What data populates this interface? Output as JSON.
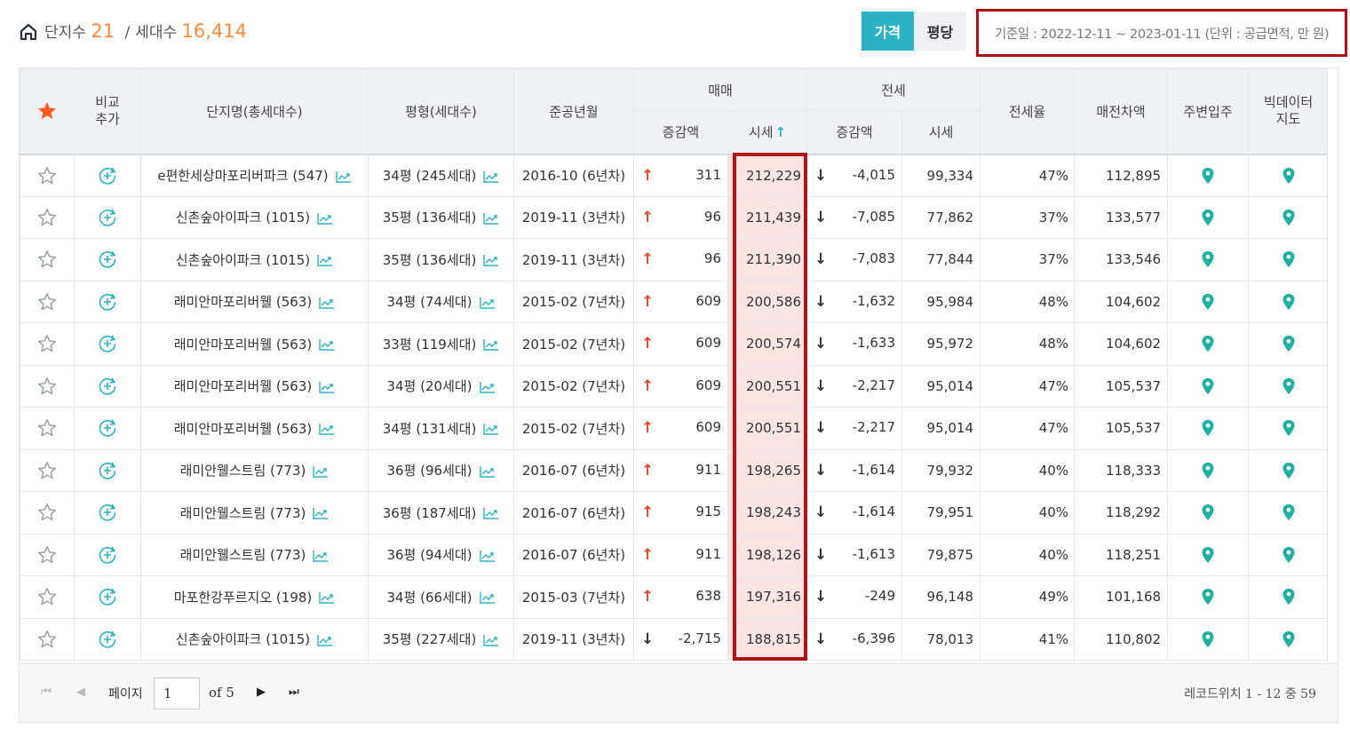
{
  "summary": {
    "complex_label": "단지수",
    "complex_count": "21",
    "separator": "/",
    "household_label": "세대수",
    "household_count": "16,414"
  },
  "toggle": {
    "price_label": "가격",
    "per_pyeong_label": "평당"
  },
  "basis_text": "기준일 : 2022-12-11 ~ 2023-01-11 (단위 : 공급면적, 만 원)",
  "headers": {
    "compare_line1": "비교",
    "compare_line2": "추가",
    "name": "단지명(총세대수)",
    "pyeong": "평형(세대수)",
    "built": "준공년월",
    "sale_group": "매매",
    "jeonse_group": "전세",
    "sale_change": "증감액",
    "sale_price": "시세",
    "jeonse_change": "증감액",
    "jeonse_price": "시세",
    "jeonse_rate": "전세율",
    "gap": "매전차액",
    "nearby": "주변입주",
    "bigdata_line1": "빅데이터",
    "bigdata_line2": "지도"
  },
  "rows": [
    {
      "name": "e편한세상마포리버파크 (547)",
      "pyeong": "34평 (245세대)",
      "built": "2016-10 (6년차)",
      "sale_dir": "up",
      "sale_change": "311",
      "sale_price": "212,229",
      "jeonse_dir": "down",
      "jeonse_change": "-4,015",
      "jeonse_price": "99,334",
      "rate": "47%",
      "gap": "112,895"
    },
    {
      "name": "신촌숲아이파크 (1015)",
      "pyeong": "35평 (136세대)",
      "built": "2019-11 (3년차)",
      "sale_dir": "up",
      "sale_change": "96",
      "sale_price": "211,439",
      "jeonse_dir": "down",
      "jeonse_change": "-7,085",
      "jeonse_price": "77,862",
      "rate": "37%",
      "gap": "133,577"
    },
    {
      "name": "신촌숲아이파크 (1015)",
      "pyeong": "35평 (136세대)",
      "built": "2019-11 (3년차)",
      "sale_dir": "up",
      "sale_change": "96",
      "sale_price": "211,390",
      "jeonse_dir": "down",
      "jeonse_change": "-7,083",
      "jeonse_price": "77,844",
      "rate": "37%",
      "gap": "133,546"
    },
    {
      "name": "래미안마포리버웰 (563)",
      "pyeong": "34평 (74세대)",
      "built": "2015-02 (7년차)",
      "sale_dir": "up",
      "sale_change": "609",
      "sale_price": "200,586",
      "jeonse_dir": "down",
      "jeonse_change": "-1,632",
      "jeonse_price": "95,984",
      "rate": "48%",
      "gap": "104,602"
    },
    {
      "name": "래미안마포리버웰 (563)",
      "pyeong": "33평 (119세대)",
      "built": "2015-02 (7년차)",
      "sale_dir": "up",
      "sale_change": "609",
      "sale_price": "200,574",
      "jeonse_dir": "down",
      "jeonse_change": "-1,633",
      "jeonse_price": "95,972",
      "rate": "48%",
      "gap": "104,602"
    },
    {
      "name": "래미안마포리버웰 (563)",
      "pyeong": "34평 (20세대)",
      "built": "2015-02 (7년차)",
      "sale_dir": "up",
      "sale_change": "609",
      "sale_price": "200,551",
      "jeonse_dir": "down",
      "jeonse_change": "-2,217",
      "jeonse_price": "95,014",
      "rate": "47%",
      "gap": "105,537"
    },
    {
      "name": "래미안마포리버웰 (563)",
      "pyeong": "34평 (131세대)",
      "built": "2015-02 (7년차)",
      "sale_dir": "up",
      "sale_change": "609",
      "sale_price": "200,551",
      "jeonse_dir": "down",
      "jeonse_change": "-2,217",
      "jeonse_price": "95,014",
      "rate": "47%",
      "gap": "105,537"
    },
    {
      "name": "래미안웰스트림 (773)",
      "pyeong": "36평 (96세대)",
      "built": "2016-07 (6년차)",
      "sale_dir": "up",
      "sale_change": "911",
      "sale_price": "198,265",
      "jeonse_dir": "down",
      "jeonse_change": "-1,614",
      "jeonse_price": "79,932",
      "rate": "40%",
      "gap": "118,333"
    },
    {
      "name": "래미안웰스트림 (773)",
      "pyeong": "36평 (187세대)",
      "built": "2016-07 (6년차)",
      "sale_dir": "up",
      "sale_change": "915",
      "sale_price": "198,243",
      "jeonse_dir": "down",
      "jeonse_change": "-1,614",
      "jeonse_price": "79,951",
      "rate": "40%",
      "gap": "118,292"
    },
    {
      "name": "래미안웰스트림 (773)",
      "pyeong": "36평 (94세대)",
      "built": "2016-07 (6년차)",
      "sale_dir": "up",
      "sale_change": "911",
      "sale_price": "198,126",
      "jeonse_dir": "down",
      "jeonse_change": "-1,613",
      "jeonse_price": "79,875",
      "rate": "40%",
      "gap": "118,251"
    },
    {
      "name": "마포한강푸르지오 (198)",
      "pyeong": "34평 (66세대)",
      "built": "2015-03 (7년차)",
      "sale_dir": "up",
      "sale_change": "638",
      "sale_price": "197,316",
      "jeonse_dir": "down",
      "jeonse_change": "-249",
      "jeonse_price": "96,148",
      "rate": "49%",
      "gap": "101,168"
    },
    {
      "name": "신촌숲아이파크 (1015)",
      "pyeong": "35평 (227세대)",
      "built": "2019-11 (3년차)",
      "sale_dir": "down",
      "sale_change": "-2,715",
      "sale_price": "188,815",
      "jeonse_dir": "down",
      "jeonse_change": "-6,396",
      "jeonse_price": "78,013",
      "rate": "41%",
      "gap": "110,802"
    }
  ],
  "pager": {
    "page_label": "페이지",
    "current_page": "1",
    "of_text": "of 5",
    "records_text": "레코드위치 1 - 12 중 59"
  },
  "colors": {
    "accent": "#2bb3c5",
    "highlight": "#b01217",
    "count": "#ff8a3d",
    "up_arrow": "#e8492a",
    "pin": "#1fb0a3",
    "price_bg": "#fbe4e4"
  }
}
